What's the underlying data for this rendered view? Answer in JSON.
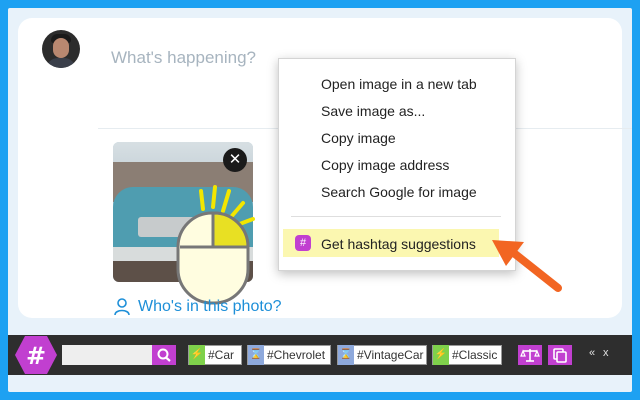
{
  "compose": {
    "placeholder": "What's happening?",
    "who_label": "Who's in this photo?"
  },
  "context_menu": {
    "items": [
      "Open image in a new tab",
      "Save image as...",
      "Copy image",
      "Copy image address",
      "Search Google for image"
    ],
    "highlight_item": "Get hashtag suggestions",
    "badge": "#"
  },
  "toolbar": {
    "logo_symbol": "#",
    "tags": [
      {
        "label": "#Car",
        "kind": "green"
      },
      {
        "label": "#Chevrolet",
        "kind": "blue"
      },
      {
        "label": "#VintageCar",
        "kind": "blue"
      },
      {
        "label": "#Classic",
        "kind": "green"
      }
    ],
    "collapse_label": "«",
    "close_label": "x"
  },
  "colors": {
    "frame_blue": "#1da1f2",
    "accent_purple": "#c13fd0",
    "arrow_orange": "#f26522",
    "highlight_yellow": "#fbf7b0",
    "link_blue": "#1d8fd8"
  },
  "icons": [
    "close-icon",
    "user-icon",
    "search-icon",
    "hashtag-logo-icon",
    "scale-icon",
    "copy-icon",
    "lightning-icon",
    "hourglass-icon"
  ]
}
